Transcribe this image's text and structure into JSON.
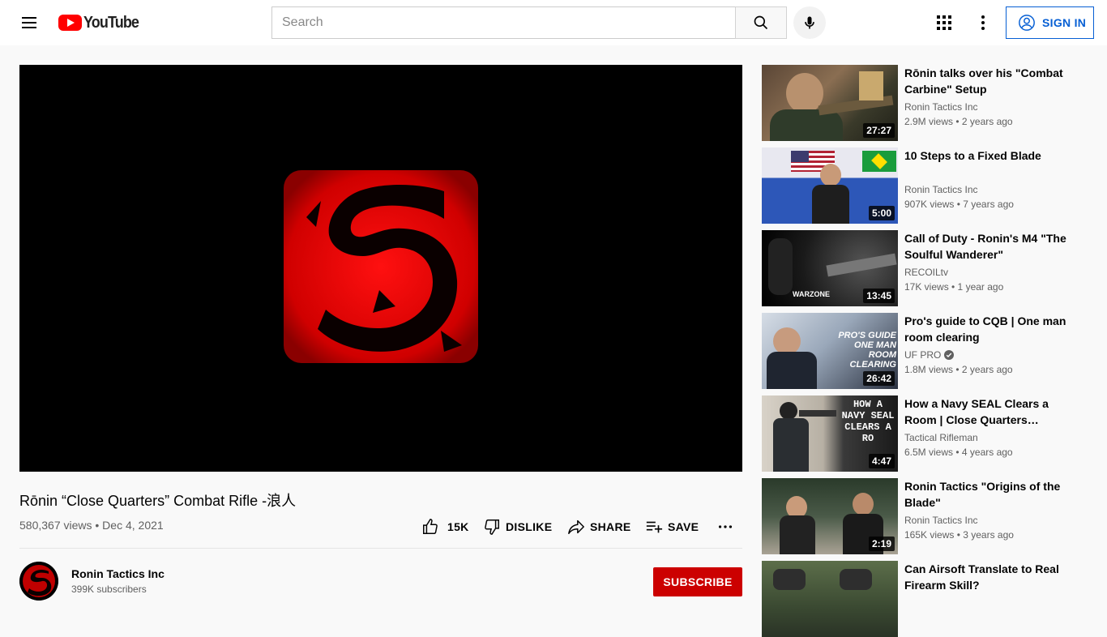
{
  "header": {
    "logo_text": "YouTube",
    "search_placeholder": "Search",
    "signin_label": "SIGN IN"
  },
  "video": {
    "title": "Rōnin “Close Quarters” Combat Rifle -浪人",
    "meta": "580,367 views • Dec 4, 2021",
    "actions": {
      "like_count": "15K",
      "dislike_label": "DISLIKE",
      "share_label": "SHARE",
      "save_label": "SAVE"
    }
  },
  "channel": {
    "name": "Ronin Tactics Inc",
    "subscribers": "399K subscribers",
    "subscribe_label": "SUBSCRIBE"
  },
  "colors": {
    "brand_red": "#ff0000",
    "subscribe_red": "#cc0000",
    "link_blue": "#065fd4"
  },
  "recommendations": [
    {
      "title": "Rōnin talks over his \"Combat Carbine\" Setup",
      "channel": "Ronin Tactics Inc",
      "stats": "2.9M views • 2 years ago",
      "duration": "27:27",
      "verified": false
    },
    {
      "title": "10 Steps to a Fixed Blade",
      "channel": "Ronin Tactics Inc",
      "stats": "907K views • 7 years ago",
      "duration": "5:00",
      "verified": false
    },
    {
      "title": "Call of Duty - Ronin's M4 \"The Soulful Wanderer\"",
      "channel": "RECOILtv",
      "stats": "17K views • 1 year ago",
      "duration": "13:45",
      "verified": false,
      "thumb_text": "WARZONE"
    },
    {
      "title": "Pro's guide to CQB | One man room clearing",
      "channel": "UF PRO",
      "stats": "1.8M views • 2 years ago",
      "duration": "26:42",
      "verified": true,
      "thumb_text": "PRO'S GUIDE ONE MAN ROOM CLEARING"
    },
    {
      "title": "How a Navy SEAL Clears a Room | Close Quarters Comba…",
      "channel": "Tactical Rifleman",
      "stats": "6.5M views • 4 years ago",
      "duration": "4:47",
      "verified": false,
      "thumb_text": "HOW A NAVY SEAL CLEARS A RO"
    },
    {
      "title": "Ronin Tactics \"Origins of the Blade\"",
      "channel": "Ronin Tactics Inc",
      "stats": "165K views • 3 years ago",
      "duration": "2:19",
      "verified": false
    },
    {
      "title": "Can Airsoft Translate to Real Firearm Skill?",
      "channel": "",
      "stats": "",
      "duration": "",
      "verified": false
    }
  ]
}
